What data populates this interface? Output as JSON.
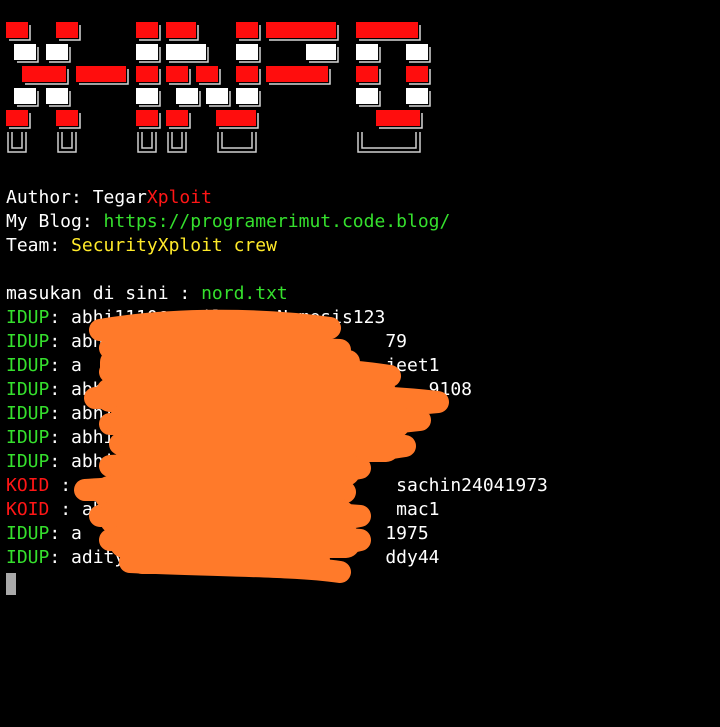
{
  "header": {
    "partial_text": ""
  },
  "info": {
    "author_label": "Author: ",
    "author_name": "Tegar",
    "author_suffix": "Xploit",
    "blog_label": "My Blog: ",
    "blog_url": "https://programerimut.code.blog/",
    "team_label": "Team: ",
    "team_name": "SecurityXploit crew"
  },
  "prompt": {
    "label": "masukan di sini : ",
    "value": "nord.txt"
  },
  "results": [
    {
      "status": "IDUP",
      "sep": ": ",
      "visible": "abhi1110@gmail.com:Nemesis123"
    },
    {
      "status": "IDUP",
      "sep": ": ",
      "visible": "abhi                         79"
    },
    {
      "status": "IDUP",
      "sep": ": ",
      "visible": "a                            jeet1"
    },
    {
      "status": "IDUP",
      "sep": ": ",
      "visible": "abhijit.w                        9108"
    },
    {
      "status": "IDUP",
      "sep": ": ",
      "visible": "abhi"
    },
    {
      "status": "IDUP",
      "sep": ": ",
      "visible": "abhi"
    },
    {
      "status": "IDUP",
      "sep": ": ",
      "visible": "abhi"
    },
    {
      "status": "KOID",
      "sep": " : ",
      "visible": "                             sachin24041973"
    },
    {
      "status": "KOID",
      "sep": " : ",
      "visible": "ab                           mac1"
    },
    {
      "status": "IDUP",
      "sep": ": ",
      "visible": "a                            1975"
    },
    {
      "status": "IDUP",
      "sep": ": ",
      "visible": "adityai                      ddy44"
    }
  ],
  "colors": {
    "background": "#000000",
    "ok": "#35e02d",
    "fail": "#ff1616",
    "team": "#ffea2a",
    "redaction": "#ff7a2a",
    "cursor": "#a9a9a9"
  },
  "icons": {
    "cursor": "terminal-cursor-block"
  }
}
